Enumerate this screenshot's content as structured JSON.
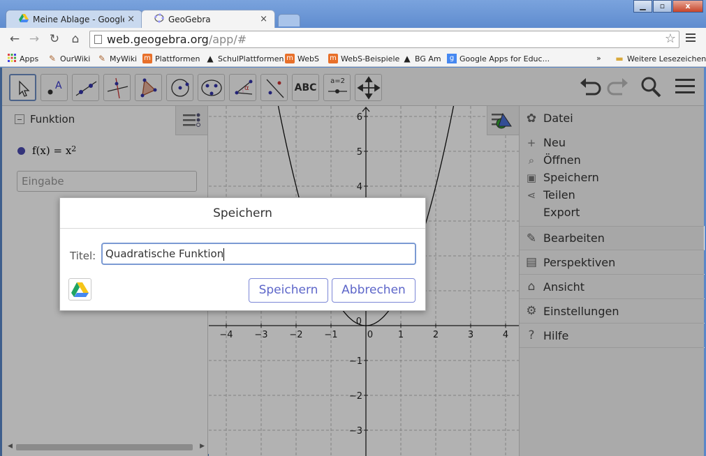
{
  "browser": {
    "tabs": [
      {
        "title": "Meine Ablage - Google Drive",
        "close": "×"
      },
      {
        "title": "GeoGebra",
        "close": "×"
      }
    ],
    "window_controls": {
      "minimize": "▁",
      "maximize": "▫",
      "close": "x"
    },
    "address": {
      "host": "web.geogebra.org",
      "path": "/app/#"
    },
    "bookmarks": [
      {
        "label": "Apps",
        "icon": "apps-grid-icon"
      },
      {
        "label": "OurWiki",
        "icon": "wiki-icon"
      },
      {
        "label": "MyWiki",
        "icon": "wiki-icon"
      },
      {
        "label": "Plattformen",
        "icon": "moodle-icon"
      },
      {
        "label": "SchulPlattformen",
        "icon": "tux-icon"
      },
      {
        "label": "WebS",
        "icon": "moodle-icon"
      },
      {
        "label": "WebS-Beispiele",
        "icon": "moodle-icon"
      },
      {
        "label": "BG Am",
        "icon": "tux-icon"
      },
      {
        "label": "Google Apps for Educ...",
        "icon": "google-icon"
      }
    ],
    "bookmarks_more": "»",
    "bookmarks_folder": "Weitere Lesezeichen"
  },
  "toolbar": {
    "text_tool": "ABC",
    "slider_tool": "a=2"
  },
  "algebra": {
    "header": "Funktion",
    "item_label": "f(x) = x",
    "item_exponent": "2",
    "input_placeholder": "Eingabe"
  },
  "graph": {
    "x_ticks": [
      "−4",
      "−3",
      "−2",
      "−1",
      "0",
      "1",
      "2",
      "3",
      "4"
    ],
    "y_ticks": [
      "6",
      "5",
      "4",
      "−1",
      "−2",
      "−3"
    ]
  },
  "menu": {
    "file": "Datei",
    "new": "Neu",
    "open": "Öffnen",
    "save": "Speichern",
    "share": "Teilen",
    "export": "Export",
    "edit": "Bearbeiten",
    "perspectives": "Perspektiven",
    "view": "Ansicht",
    "settings": "Einstellungen",
    "help": "Hilfe"
  },
  "dialog": {
    "title": "Speichern",
    "label": "Titel:",
    "value": "Quadratische Funktion",
    "save_button": "Speichern",
    "cancel_button": "Abbrechen"
  },
  "colors": {
    "accent": "#5d66c9",
    "function_dot": "#4b4bb0"
  }
}
